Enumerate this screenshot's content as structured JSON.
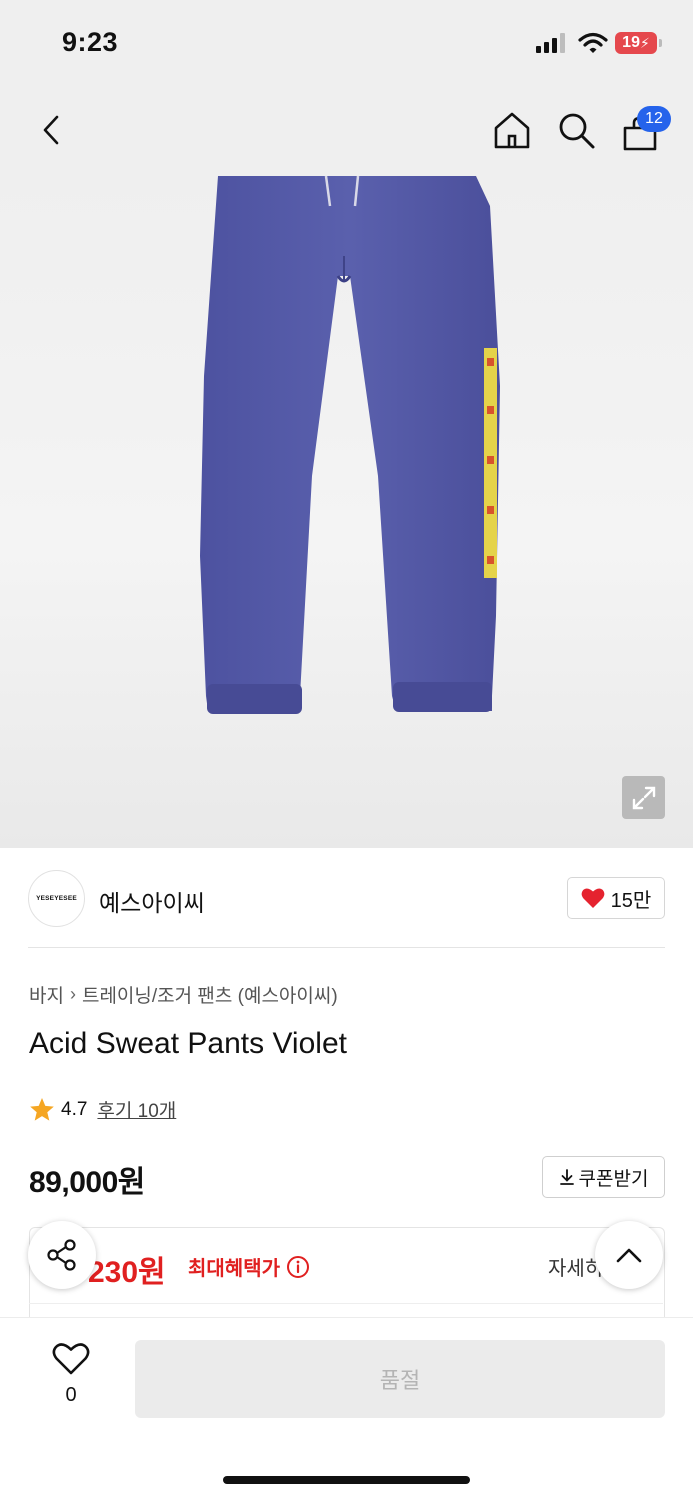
{
  "status_bar": {
    "time": "9:23",
    "battery": "19",
    "icons": [
      "cellular-signal-icon",
      "wifi-icon",
      "battery-charging-icon"
    ]
  },
  "nav": {
    "icons": [
      "back-chevron-icon",
      "home-icon",
      "search-icon",
      "shopping-bag-icon"
    ],
    "cart_count": "12"
  },
  "hero": {
    "image": "violet sweatpants product photo",
    "icon": "expand-icon"
  },
  "brand": {
    "logo_text": "YESEYESEE",
    "name": "예스아이씨",
    "like_count": "15만",
    "heart_color": "#e5232f"
  },
  "product": {
    "breadcrumb": [
      "바지",
      "트레이닝/조거 팬츠 (예스아이씨)"
    ],
    "title": "Acid Sweat Pants Violet",
    "rating": "4.7",
    "reviews": "후기 10개",
    "price": "89,000원",
    "coupon_label": "쿠폰받기"
  },
  "benefit": {
    "price": "230원",
    "label": "최대혜택가",
    "detail_link": "자세히",
    "accent_color": "#e02020"
  },
  "bottom": {
    "wish_count": "0",
    "buy_label": "품절"
  }
}
